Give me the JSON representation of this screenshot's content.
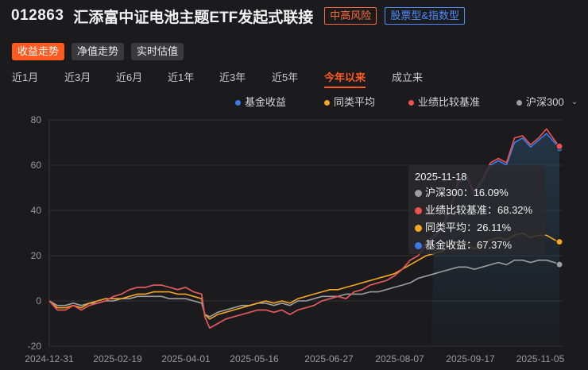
{
  "header": {
    "code": "012863",
    "name": "汇添富中证电池主题ETF发起式联接",
    "risk_tag": "中高风险",
    "type_tag": "股票型&指数型"
  },
  "mode_tabs": [
    {
      "label": "收益走势"
    },
    {
      "label": "净值走势"
    },
    {
      "label": "实时估值"
    }
  ],
  "range_tabs": [
    {
      "label": "近1月"
    },
    {
      "label": "近3月"
    },
    {
      "label": "近6月"
    },
    {
      "label": "近1年"
    },
    {
      "label": "近3年"
    },
    {
      "label": "近5年"
    },
    {
      "label": "今年以来"
    },
    {
      "label": "成立来"
    }
  ],
  "colors": {
    "fund": "#3a7bea",
    "peer": "#f5a623",
    "benchmark": "#ef5350",
    "hs300": "#9e9e9e",
    "accent": "#ff5a1f"
  },
  "legend": [
    {
      "label": "基金收益",
      "color": "#3a7bea"
    },
    {
      "label": "同类平均",
      "color": "#f5a623"
    },
    {
      "label": "业绩比较基准",
      "color": "#ef5350"
    },
    {
      "label": "沪深300",
      "color": "#9e9e9e",
      "caret": "⌄"
    }
  ],
  "tooltip": {
    "date": "2025-11-18",
    "rows": [
      {
        "label": "沪深300：16.09%",
        "color": "#9e9e9e"
      },
      {
        "label": "业绩比较基准：68.32%",
        "color": "#ef5350"
      },
      {
        "label": "同类平均：26.11%",
        "color": "#f5a623"
      },
      {
        "label": "基金收益：67.37%",
        "color": "#3a7bea"
      }
    ]
  },
  "chart_data": {
    "type": "line",
    "x_ticks": [
      "2024-12-31",
      "2025-02-19",
      "2025-04-01",
      "2025-05-16",
      "2025-06-27",
      "2025-08-07",
      "2025-09-17",
      "2025-11-05"
    ],
    "y_ticks": [
      80,
      60,
      40,
      20,
      0,
      -20
    ],
    "ylim": [
      -20,
      80
    ],
    "highlight_date": "2025-11-18",
    "series": [
      {
        "name": "基金收益",
        "color": "#3a7bea",
        "values": [
          [
            0,
            0
          ],
          [
            5,
            -4
          ],
          [
            10,
            -4
          ],
          [
            15,
            -2
          ],
          [
            20,
            -4
          ],
          [
            25,
            -2
          ],
          [
            30,
            -1
          ],
          [
            35,
            0
          ],
          [
            40,
            2
          ],
          [
            45,
            3
          ],
          [
            50,
            5
          ],
          [
            55,
            6
          ],
          [
            60,
            6
          ],
          [
            65,
            7
          ],
          [
            70,
            7
          ],
          [
            75,
            6
          ],
          [
            80,
            5
          ],
          [
            85,
            6
          ],
          [
            90,
            4
          ],
          [
            95,
            3
          ],
          [
            97,
            -7
          ],
          [
            100,
            -12
          ],
          [
            105,
            -10
          ],
          [
            110,
            -8
          ],
          [
            115,
            -7
          ],
          [
            120,
            -6
          ],
          [
            125,
            -5
          ],
          [
            130,
            -4
          ],
          [
            135,
            -4
          ],
          [
            140,
            -5
          ],
          [
            145,
            -4
          ],
          [
            150,
            -6
          ],
          [
            155,
            -4
          ],
          [
            160,
            -3
          ],
          [
            165,
            -2
          ],
          [
            170,
            0
          ],
          [
            175,
            1
          ],
          [
            180,
            2
          ],
          [
            185,
            1
          ],
          [
            190,
            4
          ],
          [
            195,
            5
          ],
          [
            200,
            7
          ],
          [
            205,
            8
          ],
          [
            210,
            9
          ],
          [
            215,
            11
          ],
          [
            220,
            14
          ],
          [
            225,
            18
          ],
          [
            230,
            20
          ],
          [
            235,
            25
          ],
          [
            240,
            28
          ],
          [
            245,
            32
          ],
          [
            250,
            40
          ],
          [
            255,
            52
          ],
          [
            260,
            55
          ],
          [
            265,
            47
          ],
          [
            270,
            53
          ],
          [
            275,
            60
          ],
          [
            280,
            62
          ],
          [
            285,
            60
          ],
          [
            290,
            70
          ],
          [
            295,
            72
          ],
          [
            300,
            68
          ],
          [
            305,
            71
          ],
          [
            310,
            74
          ],
          [
            315,
            70
          ],
          [
            318,
            67.37
          ]
        ]
      },
      {
        "name": "业绩比较基准",
        "color": "#ef5350",
        "values": [
          [
            0,
            0
          ],
          [
            5,
            -4
          ],
          [
            10,
            -4
          ],
          [
            15,
            -2
          ],
          [
            20,
            -4
          ],
          [
            25,
            -2
          ],
          [
            30,
            -1
          ],
          [
            35,
            0
          ],
          [
            40,
            2
          ],
          [
            45,
            3
          ],
          [
            50,
            5
          ],
          [
            55,
            6
          ],
          [
            60,
            6
          ],
          [
            65,
            7
          ],
          [
            70,
            7
          ],
          [
            75,
            6
          ],
          [
            80,
            5
          ],
          [
            85,
            6
          ],
          [
            90,
            4
          ],
          [
            95,
            3
          ],
          [
            97,
            -7
          ],
          [
            100,
            -12
          ],
          [
            105,
            -10
          ],
          [
            110,
            -8
          ],
          [
            115,
            -7
          ],
          [
            120,
            -6
          ],
          [
            125,
            -5
          ],
          [
            130,
            -4
          ],
          [
            135,
            -4
          ],
          [
            140,
            -5
          ],
          [
            145,
            -4
          ],
          [
            150,
            -6
          ],
          [
            155,
            -4
          ],
          [
            160,
            -3
          ],
          [
            165,
            -2
          ],
          [
            170,
            0
          ],
          [
            175,
            1
          ],
          [
            180,
            2
          ],
          [
            185,
            1
          ],
          [
            190,
            4
          ],
          [
            195,
            5
          ],
          [
            200,
            7
          ],
          [
            205,
            8
          ],
          [
            210,
            9
          ],
          [
            215,
            11
          ],
          [
            220,
            14
          ],
          [
            225,
            18
          ],
          [
            230,
            20
          ],
          [
            235,
            26
          ],
          [
            240,
            29
          ],
          [
            245,
            33
          ],
          [
            250,
            41
          ],
          [
            255,
            53
          ],
          [
            260,
            56
          ],
          [
            265,
            48
          ],
          [
            270,
            54
          ],
          [
            275,
            61
          ],
          [
            280,
            63
          ],
          [
            285,
            61
          ],
          [
            290,
            72
          ],
          [
            295,
            73
          ],
          [
            300,
            69
          ],
          [
            305,
            72
          ],
          [
            310,
            76
          ],
          [
            315,
            71
          ],
          [
            318,
            68.32
          ]
        ]
      },
      {
        "name": "同类平均",
        "color": "#f5a623",
        "values": [
          [
            0,
            0
          ],
          [
            5,
            -3
          ],
          [
            10,
            -3
          ],
          [
            15,
            -2
          ],
          [
            20,
            -3
          ],
          [
            25,
            -1
          ],
          [
            30,
            0
          ],
          [
            35,
            1
          ],
          [
            40,
            1
          ],
          [
            45,
            1
          ],
          [
            50,
            2
          ],
          [
            55,
            3
          ],
          [
            60,
            3
          ],
          [
            65,
            4
          ],
          [
            70,
            4
          ],
          [
            75,
            4
          ],
          [
            80,
            3
          ],
          [
            85,
            3
          ],
          [
            90,
            2
          ],
          [
            95,
            1
          ],
          [
            97,
            -6
          ],
          [
            100,
            -8
          ],
          [
            105,
            -6
          ],
          [
            110,
            -5
          ],
          [
            115,
            -4
          ],
          [
            120,
            -3
          ],
          [
            125,
            -2
          ],
          [
            130,
            -1
          ],
          [
            135,
            0
          ],
          [
            140,
            -1
          ],
          [
            145,
            0
          ],
          [
            150,
            -1
          ],
          [
            155,
            1
          ],
          [
            160,
            2
          ],
          [
            165,
            3
          ],
          [
            170,
            4
          ],
          [
            175,
            5
          ],
          [
            180,
            5
          ],
          [
            185,
            6
          ],
          [
            190,
            7
          ],
          [
            195,
            8
          ],
          [
            200,
            9
          ],
          [
            205,
            10
          ],
          [
            210,
            11
          ],
          [
            215,
            12
          ],
          [
            220,
            14
          ],
          [
            225,
            16
          ],
          [
            230,
            18
          ],
          [
            235,
            20
          ],
          [
            240,
            21
          ],
          [
            245,
            22
          ],
          [
            250,
            24
          ],
          [
            255,
            26
          ],
          [
            260,
            25
          ],
          [
            265,
            23
          ],
          [
            270,
            25
          ],
          [
            275,
            27
          ],
          [
            280,
            28
          ],
          [
            285,
            27
          ],
          [
            290,
            29
          ],
          [
            295,
            30
          ],
          [
            300,
            28
          ],
          [
            305,
            29
          ],
          [
            310,
            29
          ],
          [
            315,
            27
          ],
          [
            318,
            26.11
          ]
        ]
      },
      {
        "name": "沪深300",
        "color": "#9e9e9e",
        "values": [
          [
            0,
            0
          ],
          [
            5,
            -2
          ],
          [
            10,
            -2
          ],
          [
            15,
            -1
          ],
          [
            20,
            -2
          ],
          [
            25,
            -1
          ],
          [
            30,
            -1
          ],
          [
            35,
            0
          ],
          [
            40,
            0
          ],
          [
            45,
            1
          ],
          [
            50,
            1
          ],
          [
            55,
            2
          ],
          [
            60,
            2
          ],
          [
            65,
            2
          ],
          [
            70,
            2
          ],
          [
            75,
            1
          ],
          [
            80,
            1
          ],
          [
            85,
            1
          ],
          [
            90,
            0
          ],
          [
            95,
            -1
          ],
          [
            97,
            -6
          ],
          [
            100,
            -7
          ],
          [
            105,
            -5
          ],
          [
            110,
            -4
          ],
          [
            115,
            -3
          ],
          [
            120,
            -2
          ],
          [
            125,
            -2
          ],
          [
            130,
            -1
          ],
          [
            135,
            -1
          ],
          [
            140,
            -2
          ],
          [
            145,
            -1
          ],
          [
            150,
            -2
          ],
          [
            155,
            0
          ],
          [
            160,
            0
          ],
          [
            165,
            1
          ],
          [
            170,
            2
          ],
          [
            175,
            2
          ],
          [
            180,
            2
          ],
          [
            185,
            3
          ],
          [
            190,
            3
          ],
          [
            195,
            3
          ],
          [
            200,
            4
          ],
          [
            205,
            4
          ],
          [
            210,
            5
          ],
          [
            215,
            6
          ],
          [
            220,
            7
          ],
          [
            225,
            8
          ],
          [
            230,
            10
          ],
          [
            235,
            11
          ],
          [
            240,
            12
          ],
          [
            245,
            13
          ],
          [
            250,
            14
          ],
          [
            255,
            15
          ],
          [
            260,
            15
          ],
          [
            265,
            14
          ],
          [
            270,
            15
          ],
          [
            275,
            16
          ],
          [
            280,
            17
          ],
          [
            285,
            16
          ],
          [
            290,
            18
          ],
          [
            295,
            18
          ],
          [
            300,
            17
          ],
          [
            305,
            18
          ],
          [
            310,
            18
          ],
          [
            315,
            17
          ],
          [
            318,
            16.09
          ]
        ]
      }
    ]
  }
}
